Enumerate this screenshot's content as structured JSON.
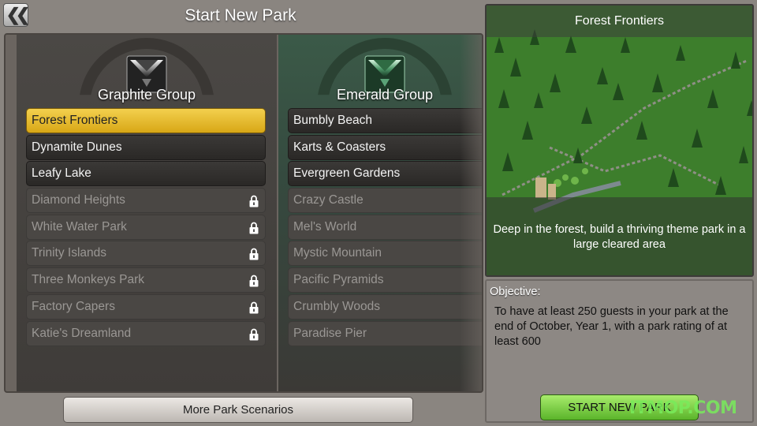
{
  "header": {
    "back_icon": "double-chevron-left-icon",
    "title": "Start New Park"
  },
  "groups": [
    {
      "name": "Graphite Group",
      "emblem_color": "#3c3c3c",
      "scenarios": [
        {
          "label": "Forest Frontiers",
          "state": "selected"
        },
        {
          "label": "Dynamite Dunes",
          "state": "unlocked"
        },
        {
          "label": "Leafy Lake",
          "state": "unlocked"
        },
        {
          "label": "Diamond Heights",
          "state": "locked"
        },
        {
          "label": "White Water Park",
          "state": "locked"
        },
        {
          "label": "Trinity Islands",
          "state": "locked"
        },
        {
          "label": "Three Monkeys Park",
          "state": "locked"
        },
        {
          "label": "Factory Capers",
          "state": "locked"
        },
        {
          "label": "Katie's Dreamland",
          "state": "locked"
        }
      ]
    },
    {
      "name": "Emerald Group",
      "emblem_color": "#2f6b43",
      "scenarios": [
        {
          "label": "Bumbly Beach",
          "state": "unlocked"
        },
        {
          "label": "Karts & Coasters",
          "state": "unlocked"
        },
        {
          "label": "Evergreen Gardens",
          "state": "unlocked"
        },
        {
          "label": "Crazy Castle",
          "state": "locked"
        },
        {
          "label": "Mel's World",
          "state": "locked"
        },
        {
          "label": "Mystic Mountain",
          "state": "locked"
        },
        {
          "label": "Pacific Pyramids",
          "state": "locked"
        },
        {
          "label": "Crumbly Woods",
          "state": "locked"
        },
        {
          "label": "Paradise Pier",
          "state": "locked"
        }
      ]
    }
  ],
  "more_button": "More Park Scenarios",
  "preview": {
    "title": "Forest Frontiers",
    "description": "Deep in the forest, build a thriving theme park in a large cleared area"
  },
  "objective": {
    "label": "Objective:",
    "text": "To have at least 250 guests in your park at the end of October, Year 1, with a park rating of at least 600"
  },
  "start_button": "START NEW PARK",
  "watermark": "ITMOP.COM",
  "colors": {
    "selected": "#e6bb2c",
    "start_button": "#7fd24a",
    "emerald_column": "#3b5a48"
  }
}
